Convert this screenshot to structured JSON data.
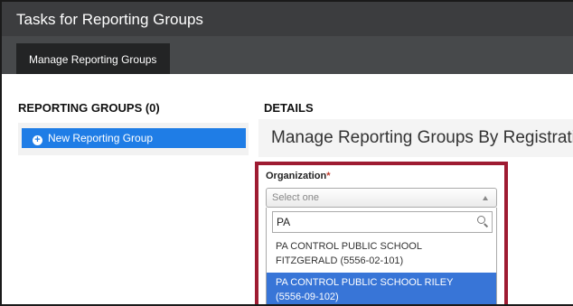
{
  "window": {
    "title": "Tasks for Reporting Groups"
  },
  "tabs": [
    {
      "label": "Manage Reporting Groups"
    }
  ],
  "sidebar": {
    "heading": "REPORTING GROUPS (0)",
    "new_button_label": "New Reporting Group",
    "new_button_icon": "plus-circle-icon"
  },
  "details": {
    "heading": "DETAILS",
    "banner_title": "Manage Reporting Groups By Registration"
  },
  "organization": {
    "label": "Organization",
    "required_mark": "*",
    "select_placeholder": "Select one",
    "search_value": "PA",
    "options": [
      {
        "line1": "PA CONTROL PUBLIC SCHOOL",
        "line2": "FITZGERALD (5556-02-101)"
      },
      {
        "line1": "PA CONTROL PUBLIC SCHOOL RILEY",
        "line2": "(5556-09-102)"
      }
    ],
    "highlighted_option_index": 1
  },
  "colors": {
    "titlebar": "#3c3d3f",
    "tabbar": "#47494b",
    "primary": "#1f7de6",
    "highlight": "#3875d7",
    "outline": "#9e1b32"
  }
}
